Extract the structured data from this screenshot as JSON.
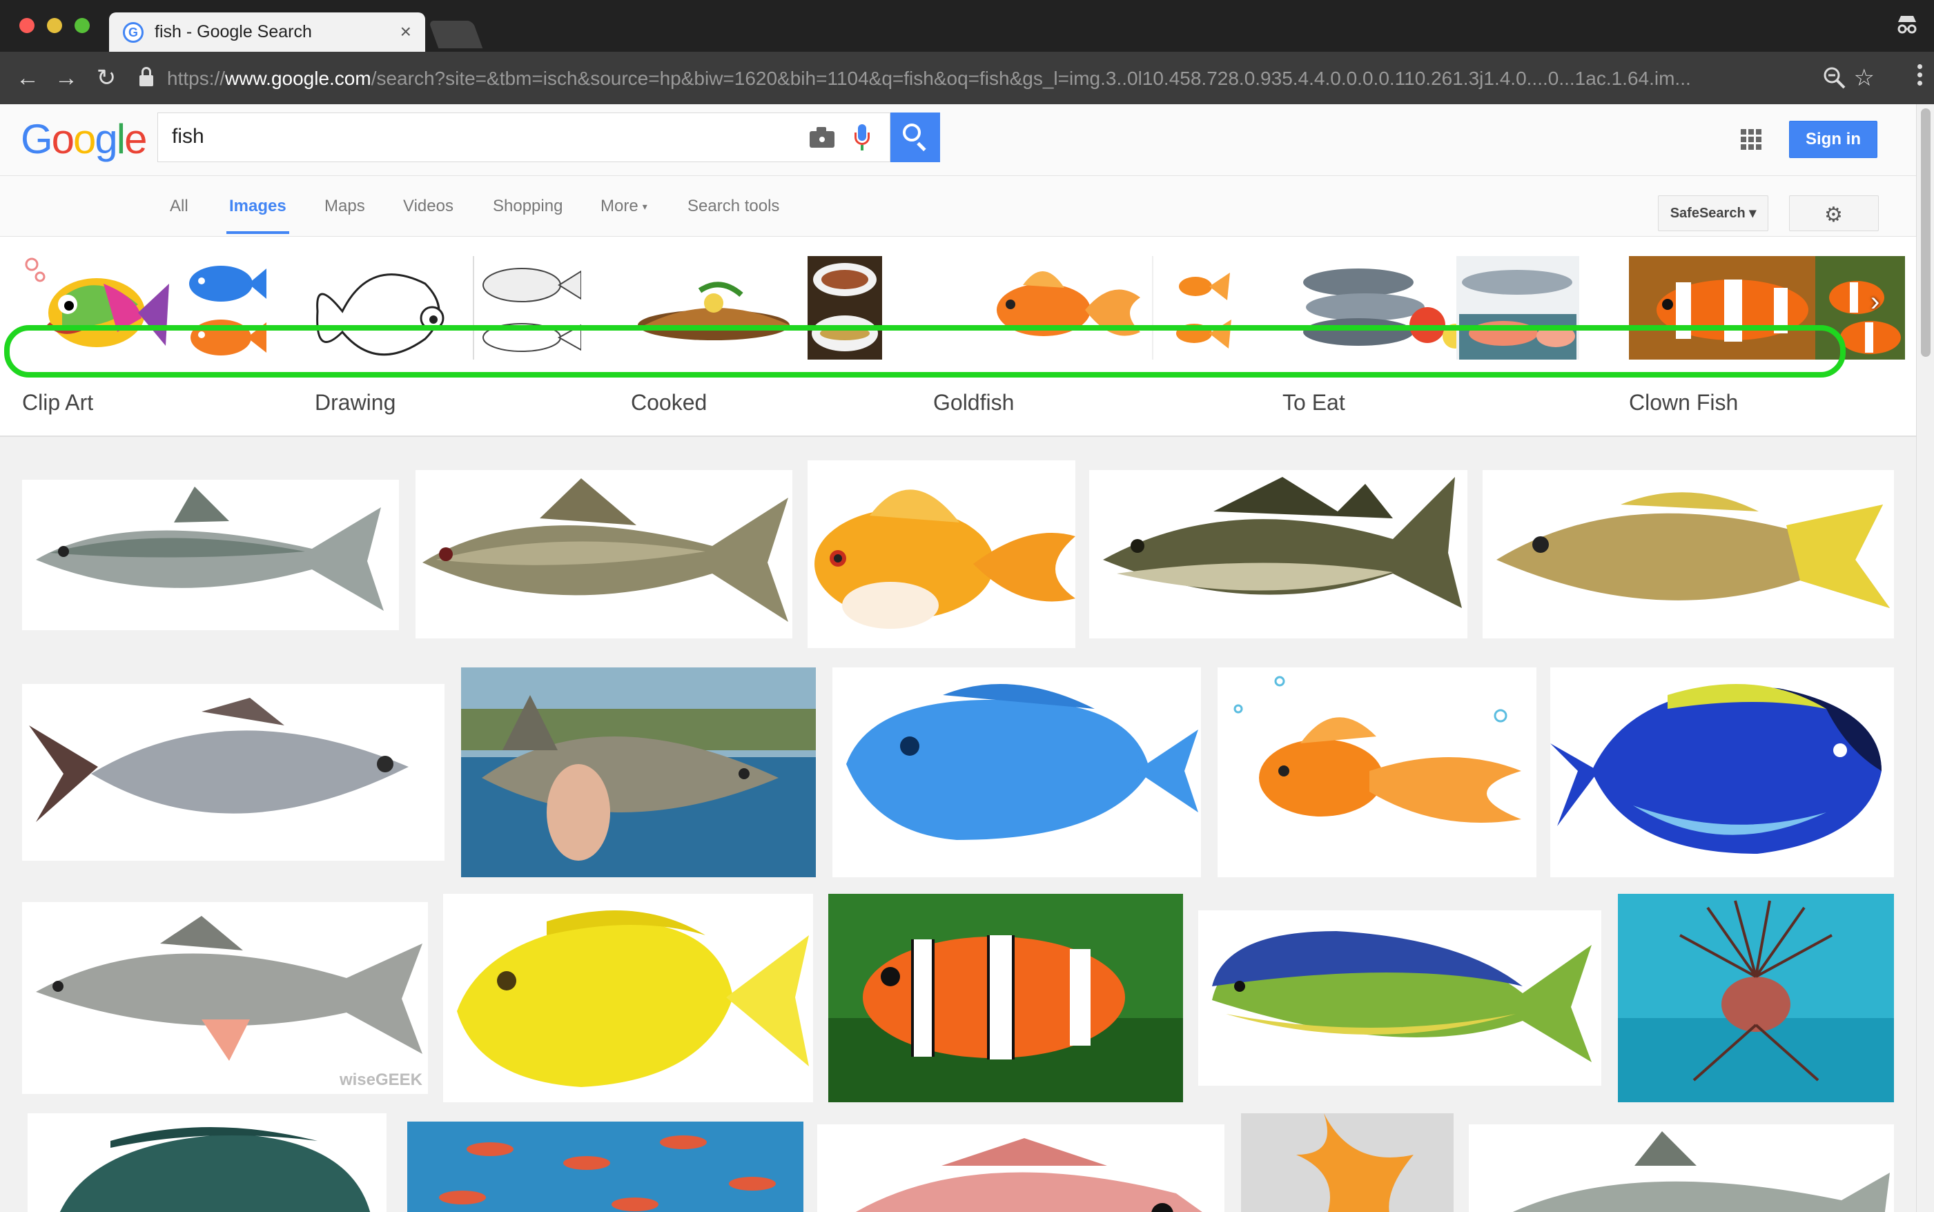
{
  "browser": {
    "tab_title": "fish - Google Search",
    "tab_close": "×",
    "url_scheme": "https://",
    "url_host": "www.google.com",
    "url_path": "/search?site=&tbm=isch&source=hp&biw=1620&bih=1104&q=fish&oq=fish&gs_l=img.3..0l10.458.728.0.935.4.4.0.0.0.0.110.261.3j1.4.0....0...1ac.1.64.im..."
  },
  "google": {
    "logo": [
      "G",
      "o",
      "o",
      "g",
      "l",
      "e"
    ],
    "search_value": "fish",
    "sign_in": "Sign in",
    "tabs": [
      {
        "label": "All"
      },
      {
        "label": "Images"
      },
      {
        "label": "Maps"
      },
      {
        "label": "Videos"
      },
      {
        "label": "Shopping"
      },
      {
        "label": "More"
      },
      {
        "label": "Search tools"
      }
    ],
    "more_caret": "▾",
    "safesearch": "SafeSearch ▾"
  },
  "related": [
    {
      "label": "Clip Art"
    },
    {
      "label": "Drawing"
    },
    {
      "label": "Cooked"
    },
    {
      "label": "Goldfish"
    },
    {
      "label": "To Eat"
    },
    {
      "label": "Clown Fish"
    }
  ],
  "results": {
    "watermark": "wiseGEEK"
  },
  "icons": {
    "back": "←",
    "forward": "→",
    "reload": "↻",
    "star": "☆",
    "gear": "⚙",
    "next": "›"
  },
  "colors": {
    "accent_blue": "#4285f4",
    "highlight_green": "#1fd61f"
  }
}
